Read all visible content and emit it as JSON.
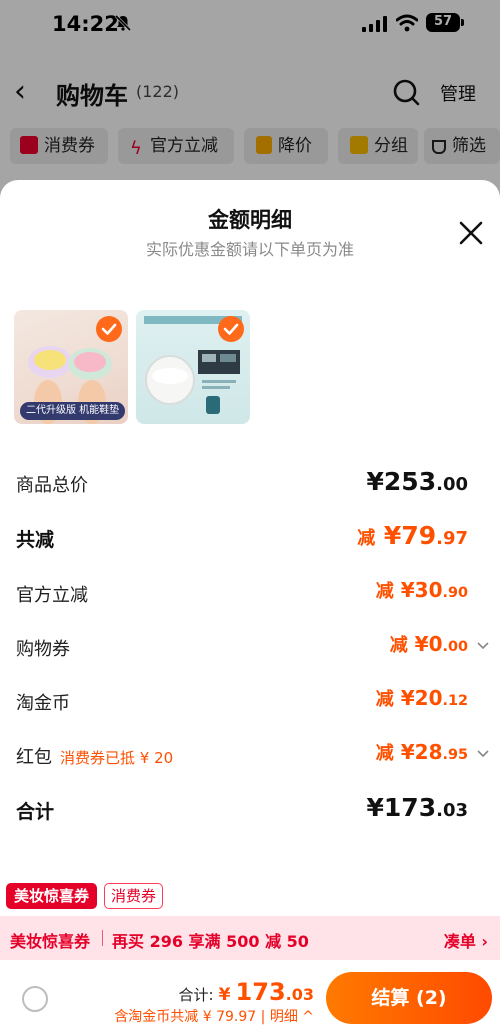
{
  "status_bar": {
    "time": "14:22",
    "battery": "57"
  },
  "nav": {
    "title": "购物车",
    "count": "(122)",
    "manage": "管理"
  },
  "filters": [
    {
      "label": "消费券",
      "icon": "coupon-icon"
    },
    {
      "label": "官方立减",
      "icon": "lightning-icon"
    },
    {
      "label": "降价",
      "icon": "price-drop-icon"
    },
    {
      "label": "分组",
      "icon": "folder-icon"
    },
    {
      "label": "筛选",
      "icon": "filter-icon"
    }
  ],
  "sheet": {
    "title": "金额明细",
    "subtitle": "实际优惠金额请以下单页为准",
    "products": [
      {
        "caption": "二代升级版 机能鞋垫",
        "selected": true
      },
      {
        "caption": "",
        "selected": true
      }
    ],
    "rows": [
      {
        "label": "商品总价",
        "prefix": "",
        "int": "¥253",
        "dec": ".00"
      },
      {
        "label": "共减",
        "prefix": "减",
        "int": "¥79",
        "dec": ".97"
      },
      {
        "label": "官方立减",
        "prefix": "减",
        "int": "¥30",
        "dec": ".90"
      },
      {
        "label": "购物券",
        "prefix": "减",
        "int": "¥0",
        "dec": ".00"
      },
      {
        "label": "淘金币",
        "prefix": "减",
        "int": "¥20",
        "dec": ".12"
      },
      {
        "label": "红包",
        "note": "消费券已抵 ¥ 20",
        "prefix": "减",
        "int": "¥28",
        "dec": ".95"
      },
      {
        "label": "合计",
        "prefix": "",
        "int": "¥173",
        "dec": ".03"
      }
    ]
  },
  "tags": {
    "primary": "美妆惊喜券",
    "secondary": "消费券"
  },
  "promo": {
    "tag": "美妆惊喜券",
    "text": "再买 296 享满 500 减 50",
    "link": "凑单 ›"
  },
  "footer": {
    "total_label": "合计:",
    "total_yen": "¥",
    "total_int": "173",
    "total_dec": ".03",
    "sub": "含淘金币共减 ¥ 79.97 | 明细 ^",
    "checkout": "结算 (2)"
  },
  "colors": {
    "accent": "#ff5000",
    "promo_red": "#e5002a",
    "checkout_start": "#ff7a00",
    "checkout_end": "#ff4a00"
  }
}
